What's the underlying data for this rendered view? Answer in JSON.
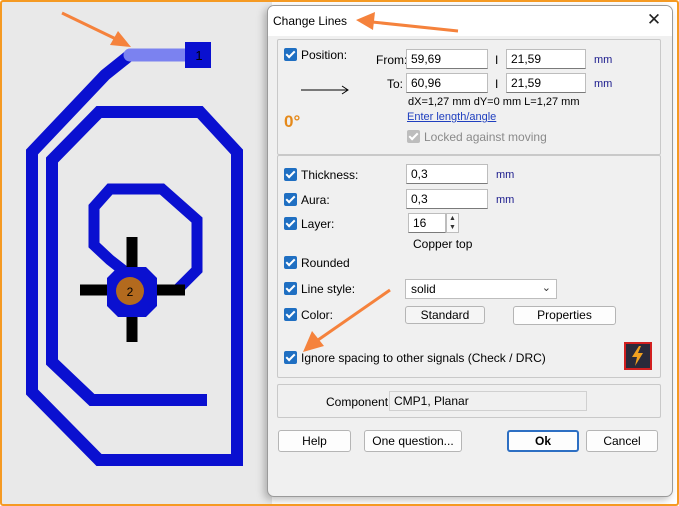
{
  "dialog": {
    "title": "Change Lines",
    "close_glyph": "✕"
  },
  "canvas": {
    "pad1_label": "1",
    "pad2_label": "2",
    "colors": {
      "track": "#0a10d0",
      "selected_track": "#7b82f0",
      "pad": "#b36a1e",
      "background": "#e9e9e9"
    }
  },
  "position": {
    "label": "Position:",
    "from_label": "From:",
    "to_label": "To:",
    "from_x": "59,69",
    "from_y": "21,59",
    "to_x": "60,96",
    "to_y": "21,59",
    "separator": "I",
    "unit": "mm",
    "deltas": "dX=1,27 mm  dY=0 mm  L=1,27 mm",
    "angle": "0°",
    "enter_link": "Enter length/angle",
    "locked_label": "Locked against moving"
  },
  "properties": {
    "thickness_label": "Thickness:",
    "thickness_value": "0,3",
    "aura_label": "Aura:",
    "aura_value": "0,3",
    "unit": "mm",
    "layer_label": "Layer:",
    "layer_value": "16",
    "layer_name": "Copper top",
    "rounded_label": "Rounded",
    "linestyle_label": "Line style:",
    "linestyle_value": "solid",
    "color_label": "Color:",
    "standard_button": "Standard",
    "properties_button": "Properties",
    "ignore_label": "Ignore spacing to other signals (Check / DRC)"
  },
  "component": {
    "label": "Component:",
    "value": "CMP1, Planar"
  },
  "buttons": {
    "help": "Help",
    "question": "One question...",
    "ok": "Ok",
    "cancel": "Cancel"
  },
  "annotation_color": "#f5823c"
}
